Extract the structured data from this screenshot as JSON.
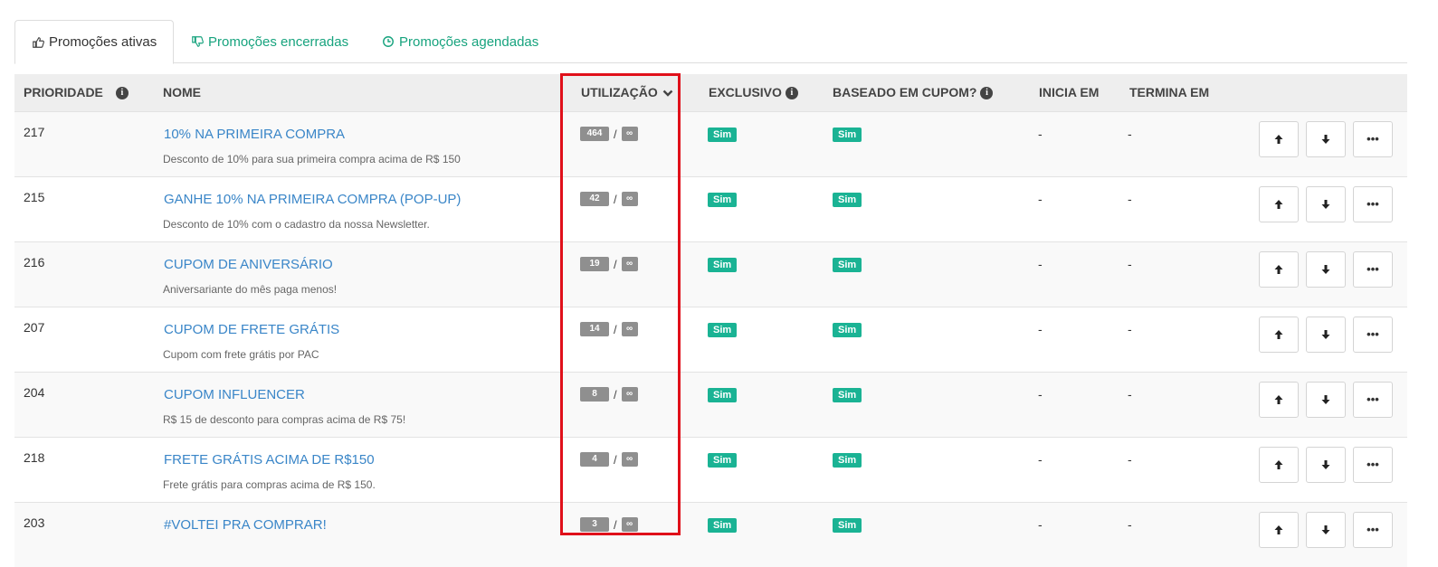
{
  "tabs": [
    {
      "label": "Promoções ativas",
      "icon": "thumbs-up-icon"
    },
    {
      "label": "Promoções encerradas",
      "icon": "thumbs-down-icon"
    },
    {
      "label": "Promoções agendadas",
      "icon": "clock-icon"
    }
  ],
  "headers": {
    "prioridade": "PRIORIDADE",
    "nome": "NOME",
    "utilizacao": "UTILIZAÇÃO",
    "exclusivo": "EXCLUSIVO",
    "baseado": "BASEADO EM CUPOM?",
    "inicia": "INICIA EM",
    "termina": "TERMINA EM"
  },
  "rows": [
    {
      "prioridade": "217",
      "nome": "10% NA PRIMEIRA COMPRA",
      "descricao": "Desconto de 10% para sua primeira compra acima de R$ 150",
      "uso": "464",
      "limite": "∞",
      "separador": "/",
      "exclusivo": "Sim",
      "cupom": "Sim",
      "inicia": "-",
      "termina": "-"
    },
    {
      "prioridade": "215",
      "nome": "GANHE 10% NA PRIMEIRA COMPRA (POP-UP)",
      "descricao": "Desconto de 10% com o cadastro da nossa Newsletter.",
      "uso": "42",
      "limite": "∞",
      "separador": "/",
      "exclusivo": "Sim",
      "cupom": "Sim",
      "inicia": "-",
      "termina": "-"
    },
    {
      "prioridade": "216",
      "nome": "CUPOM DE ANIVERSÁRIO",
      "descricao": "Aniversariante do mês paga menos!",
      "uso": "19",
      "limite": "∞",
      "separador": "/",
      "exclusivo": "Sim",
      "cupom": "Sim",
      "inicia": "-",
      "termina": "-"
    },
    {
      "prioridade": "207",
      "nome": "CUPOM DE FRETE GRÁTIS",
      "descricao": "Cupom com frete grátis por PAC",
      "uso": "14",
      "limite": "∞",
      "separador": "/",
      "exclusivo": "Sim",
      "cupom": "Sim",
      "inicia": "-",
      "termina": "-"
    },
    {
      "prioridade": "204",
      "nome": "CUPOM INFLUENCER",
      "descricao": "R$ 15 de desconto para compras acima de R$ 75!",
      "uso": "8",
      "limite": "∞",
      "separador": "/",
      "exclusivo": "Sim",
      "cupom": "Sim",
      "inicia": "-",
      "termina": "-"
    },
    {
      "prioridade": "218",
      "nome": "FRETE GRÁTIS ACIMA DE R$150",
      "descricao": "Frete grátis para compras acima de R$ 150.",
      "uso": "4",
      "limite": "∞",
      "separador": "/",
      "exclusivo": "Sim",
      "cupom": "Sim",
      "inicia": "-",
      "termina": "-"
    },
    {
      "prioridade": "203",
      "nome": "#VOLTEI PRA COMPRAR!",
      "descricao": "",
      "uso": "3",
      "limite": "∞",
      "separador": "/",
      "exclusivo": "Sim",
      "cupom": "Sim",
      "inicia": "-",
      "termina": "-"
    }
  ],
  "actions": {
    "up_icon": "arrow-up-icon",
    "down_icon": "arrow-down-icon",
    "more_label": "•••"
  },
  "colors": {
    "link": "#3a86c8",
    "green": "#1ab394",
    "tab_green": "#17a37e",
    "highlight": "#e0101a",
    "badge_gray": "#8f8f8f"
  }
}
